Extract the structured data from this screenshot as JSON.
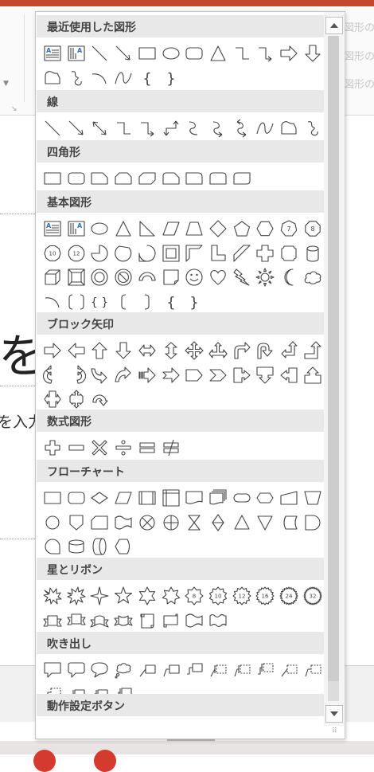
{
  "background": {
    "slide_char": "を",
    "slide_text": "を入力",
    "style_snippets": [
      "図形の",
      "図形の",
      "図形の"
    ]
  },
  "dropdown": {
    "sections": [
      {
        "key": "recent",
        "title": "最近使用した図形",
        "rows": [
          [
            "textbox",
            "vtextbox",
            "line",
            "arrow",
            "rect",
            "oval",
            "roundrect",
            "triangle",
            "elbow",
            "elbowarrow",
            "rightarrow",
            "downarrow"
          ],
          [
            "freeform",
            "scribble",
            "arc",
            "curve",
            "lbrace",
            "rbrace"
          ]
        ]
      },
      {
        "key": "lines",
        "title": "線",
        "rows": [
          [
            "line",
            "arrow",
            "dblarrow",
            "elbow",
            "elbowarrow",
            "elbowdbl",
            "curvedconn",
            "curvedconnarrow",
            "curvedconndbl",
            "curve",
            "freeform",
            "scribble"
          ]
        ]
      },
      {
        "key": "rects",
        "title": "四角形",
        "rows": [
          [
            "rect",
            "roundrect",
            "snip1",
            "snip2same",
            "snip2diag",
            "sniproundtop",
            "round1",
            "round2same",
            "round2diag"
          ]
        ]
      },
      {
        "key": "basic",
        "title": "基本図形",
        "rows": [
          [
            "textbox",
            "vtextbox",
            "oval",
            "triangle",
            "rtriangle",
            "parallelogram",
            "trapezoid",
            "diamond",
            "pentagon",
            "hexagon",
            "heptagon",
            "octagon"
          ],
          [
            "decagon",
            "dodecagon",
            "pie",
            "chord",
            "teardrop",
            "frame",
            "halfframe",
            "lshape",
            "diagstripe",
            "cross",
            "plaque",
            "can"
          ],
          [
            "cube",
            "bevel",
            "donut",
            "noentry",
            "blockarc",
            "foldedcorner",
            "smiley",
            "heart",
            "lightning",
            "sun",
            "moon",
            "cloud"
          ],
          [
            "arc",
            "bracketpair",
            "bracepair",
            "lbracket",
            "rbracket",
            "lbrace",
            "rbrace"
          ]
        ]
      },
      {
        "key": "block",
        "title": "ブロック矢印",
        "rows": [
          [
            "rightarrow",
            "leftarrow",
            "uparrow",
            "downarrow",
            "lrarrow",
            "udarrow",
            "quadarrow",
            "lruparrow",
            "bentarrow",
            "uturnarrow",
            "lupbent",
            "bentup"
          ],
          [
            "ccwcircular",
            "cwcircular",
            "curvedup",
            "curveddown",
            "stripedright",
            "notchedright",
            "homeplate",
            "chevron",
            "rightcallout",
            "downcallout",
            "leftcallout",
            "upcallout"
          ],
          [
            "lrcallout",
            "quadcallout",
            "circulararrow"
          ]
        ]
      },
      {
        "key": "equation",
        "title": "数式図形",
        "rows": [
          [
            "plus",
            "minus",
            "multiply",
            "divide",
            "equal",
            "notequal"
          ]
        ]
      },
      {
        "key": "flow",
        "title": "フローチャート",
        "rows": [
          [
            "fc-process",
            "fc-alt",
            "fc-decision",
            "fc-data",
            "fc-predefined",
            "fc-internal",
            "fc-document",
            "fc-multidoc",
            "fc-terminator",
            "fc-prep",
            "fc-manual",
            "fc-manualop"
          ],
          [
            "fc-connector",
            "fc-offpage",
            "fc-card",
            "fc-punchedtape",
            "fc-sumjunction",
            "fc-or",
            "fc-collate",
            "fc-sort",
            "fc-extract",
            "fc-merge",
            "fc-stored",
            "fc-delay"
          ],
          [
            "fc-tape",
            "fc-disk",
            "fc-drum",
            "fc-display"
          ]
        ]
      },
      {
        "key": "stars",
        "title": "星とリボン",
        "rows": [
          [
            "explosion1",
            "explosion2",
            "star4",
            "star5",
            "star6",
            "star7",
            "star8",
            "star10",
            "star12",
            "star16",
            "star24",
            "star32"
          ],
          [
            "ribbonup",
            "ribbondown",
            "curvedribbonup",
            "curvedribbondown",
            "vscroll",
            "hscroll",
            "wave",
            "doublewave"
          ]
        ]
      },
      {
        "key": "callouts",
        "title": "吹き出し",
        "rows": [
          [
            "rectcallout",
            "roundcallout",
            "ovalcallout",
            "cloudcallout",
            "linecallout1",
            "linecallout2",
            "linecallout3",
            "accentcallout1",
            "accentcallout2",
            "accentcallout3",
            "bordercallout1",
            "bordercallout2"
          ],
          [
            "bordercallout3",
            "accentborder1",
            "accentborder2",
            "accentborder3"
          ]
        ]
      },
      {
        "key": "action",
        "title": "動作設定ボタン",
        "rows": []
      }
    ]
  },
  "star_labels": {
    "star8": "8",
    "star10": "10",
    "star12": "12",
    "star16": "16",
    "star24": "24",
    "star32": "32",
    "heptagon": "7",
    "octagon": "8",
    "decagon": "10",
    "dodecagon": "12"
  },
  "textbox_label": "A",
  "accent_color": "#2e74b5",
  "icon_color": "#444444"
}
